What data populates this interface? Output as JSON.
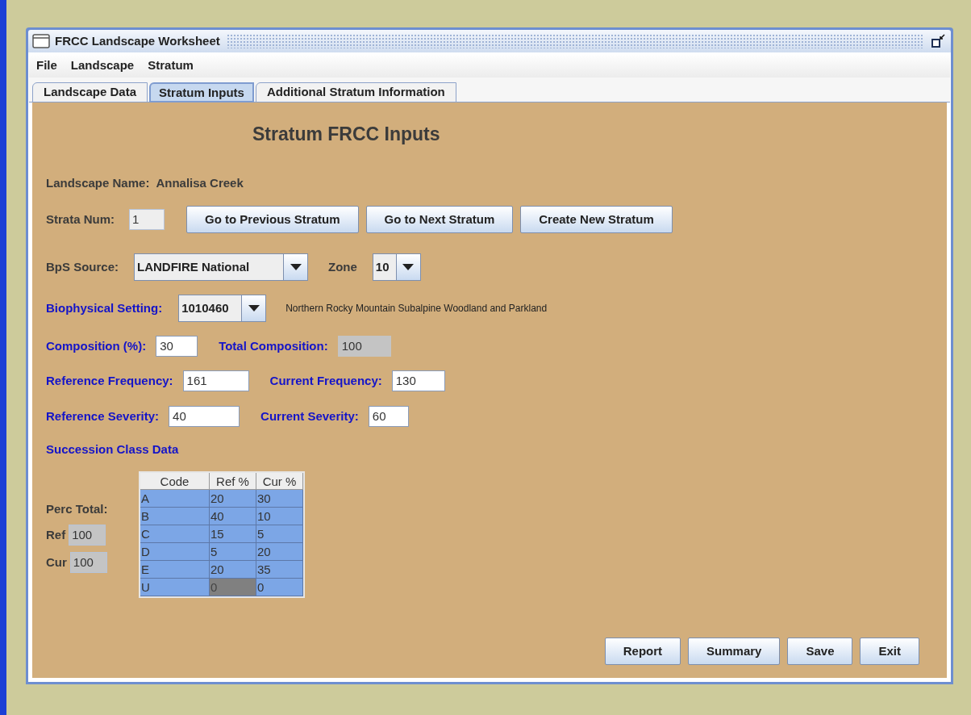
{
  "window": {
    "title": "FRCC Landscape Worksheet"
  },
  "menu": [
    "File",
    "Landscape",
    "Stratum"
  ],
  "tabs": [
    {
      "label": "Landscape Data",
      "selected": false
    },
    {
      "label": "Stratum Inputs",
      "selected": true
    },
    {
      "label": "Additional Stratum Information",
      "selected": false
    }
  ],
  "heading": "Stratum FRCC Inputs",
  "landscape_name": {
    "label": "Landscape Name:",
    "value": "Annalisa Creek"
  },
  "strata_num": {
    "label": "Strata Num:",
    "value": "1"
  },
  "stratum_buttons": [
    "Go to Previous Stratum",
    "Go to Next Stratum",
    "Create New Stratum"
  ],
  "bps_source": {
    "label": "BpS Source:",
    "value": "LANDFIRE National"
  },
  "zone": {
    "label": "Zone",
    "value": "10"
  },
  "biophysical_setting": {
    "label": "Biophysical Setting:",
    "value": "1010460",
    "description": "Northern Rocky Mountain Subalpine Woodland and Parkland"
  },
  "field_rows": [
    [
      {
        "label": "Composition (%):",
        "value": "30",
        "editable": true
      },
      {
        "label": "Total Composition:",
        "value": "100",
        "editable": false
      }
    ],
    [
      {
        "label": "Reference Frequency:",
        "value": "161",
        "editable": true
      },
      {
        "label": "Current Frequency:",
        "value": "130",
        "editable": true
      }
    ],
    [
      {
        "label": "Reference Severity:",
        "value": "40",
        "editable": true
      },
      {
        "label": "Current Severity:",
        "value": "60",
        "editable": true
      }
    ]
  ],
  "succession_heading": "Succession Class Data",
  "perc_total": {
    "label": "Perc Total:",
    "ref_label": "Ref",
    "ref_value": "100",
    "cur_label": "Cur",
    "cur_value": "100"
  },
  "table": {
    "columns": [
      "Code",
      "Ref %",
      "Cur %"
    ],
    "rows": [
      [
        {
          "text": "A",
          "selected": false
        },
        {
          "text": "20",
          "selected": false
        },
        {
          "text": "30",
          "selected": false
        }
      ],
      [
        {
          "text": "B",
          "selected": false
        },
        {
          "text": "40",
          "selected": false
        },
        {
          "text": "10",
          "selected": false
        }
      ],
      [
        {
          "text": "C",
          "selected": false
        },
        {
          "text": "15",
          "selected": false
        },
        {
          "text": "5",
          "selected": false
        }
      ],
      [
        {
          "text": "D",
          "selected": false
        },
        {
          "text": "5",
          "selected": false
        },
        {
          "text": "20",
          "selected": false
        }
      ],
      [
        {
          "text": "E",
          "selected": false
        },
        {
          "text": "20",
          "selected": false
        },
        {
          "text": "35",
          "selected": false
        }
      ],
      [
        {
          "text": "U",
          "selected": false
        },
        {
          "text": "0",
          "selected": true
        },
        {
          "text": "0",
          "selected": false
        }
      ]
    ]
  },
  "action_buttons": [
    "Report",
    "Summary",
    "Save",
    "Exit"
  ]
}
